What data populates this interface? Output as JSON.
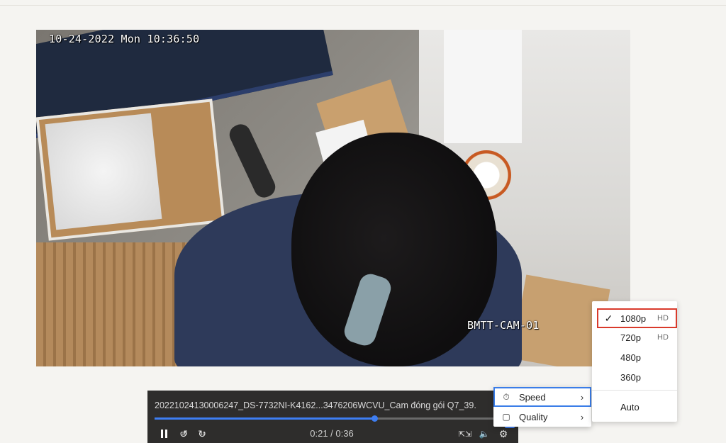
{
  "video": {
    "osd_timestamp": "10-24-2022 Mon 10:36:50",
    "osd_camera": "BMTT-CAM-01"
  },
  "player": {
    "title": "20221024130006247_DS-7732NI-K4162...3476206WCVU_Cam đóng gói Q7_39.",
    "current_time": "0:21",
    "duration": "0:36",
    "time_display": "0:21 / 0:36",
    "progress_fraction": 0.645,
    "hd_badge": "HD",
    "skip_back_seconds": "10",
    "skip_forward_seconds": "10",
    "icons": [
      "pause-icon",
      "skip-back-icon",
      "skip-forward-icon",
      "fullscreen-icon",
      "volume-icon",
      "gear-icon"
    ]
  },
  "settings_menu": {
    "items": [
      {
        "label": "Speed",
        "icon": "speedometer-icon",
        "highlighted": true
      },
      {
        "label": "Quality",
        "icon": "video-camera-icon",
        "highlighted": false
      }
    ]
  },
  "quality_menu": {
    "options": [
      {
        "label": "1080p",
        "badge": "HD",
        "selected": true
      },
      {
        "label": "720p",
        "badge": "HD",
        "selected": false
      },
      {
        "label": "480p",
        "badge": "",
        "selected": false
      },
      {
        "label": "360p",
        "badge": "",
        "selected": false
      },
      {
        "label": "Auto",
        "badge": "",
        "selected": false
      }
    ]
  },
  "colors": {
    "accent": "#3e7ef2",
    "selection_outline": "#d93a2b",
    "player_bg": "#2e2d2c",
    "page_bg": "#f5f4f1"
  }
}
